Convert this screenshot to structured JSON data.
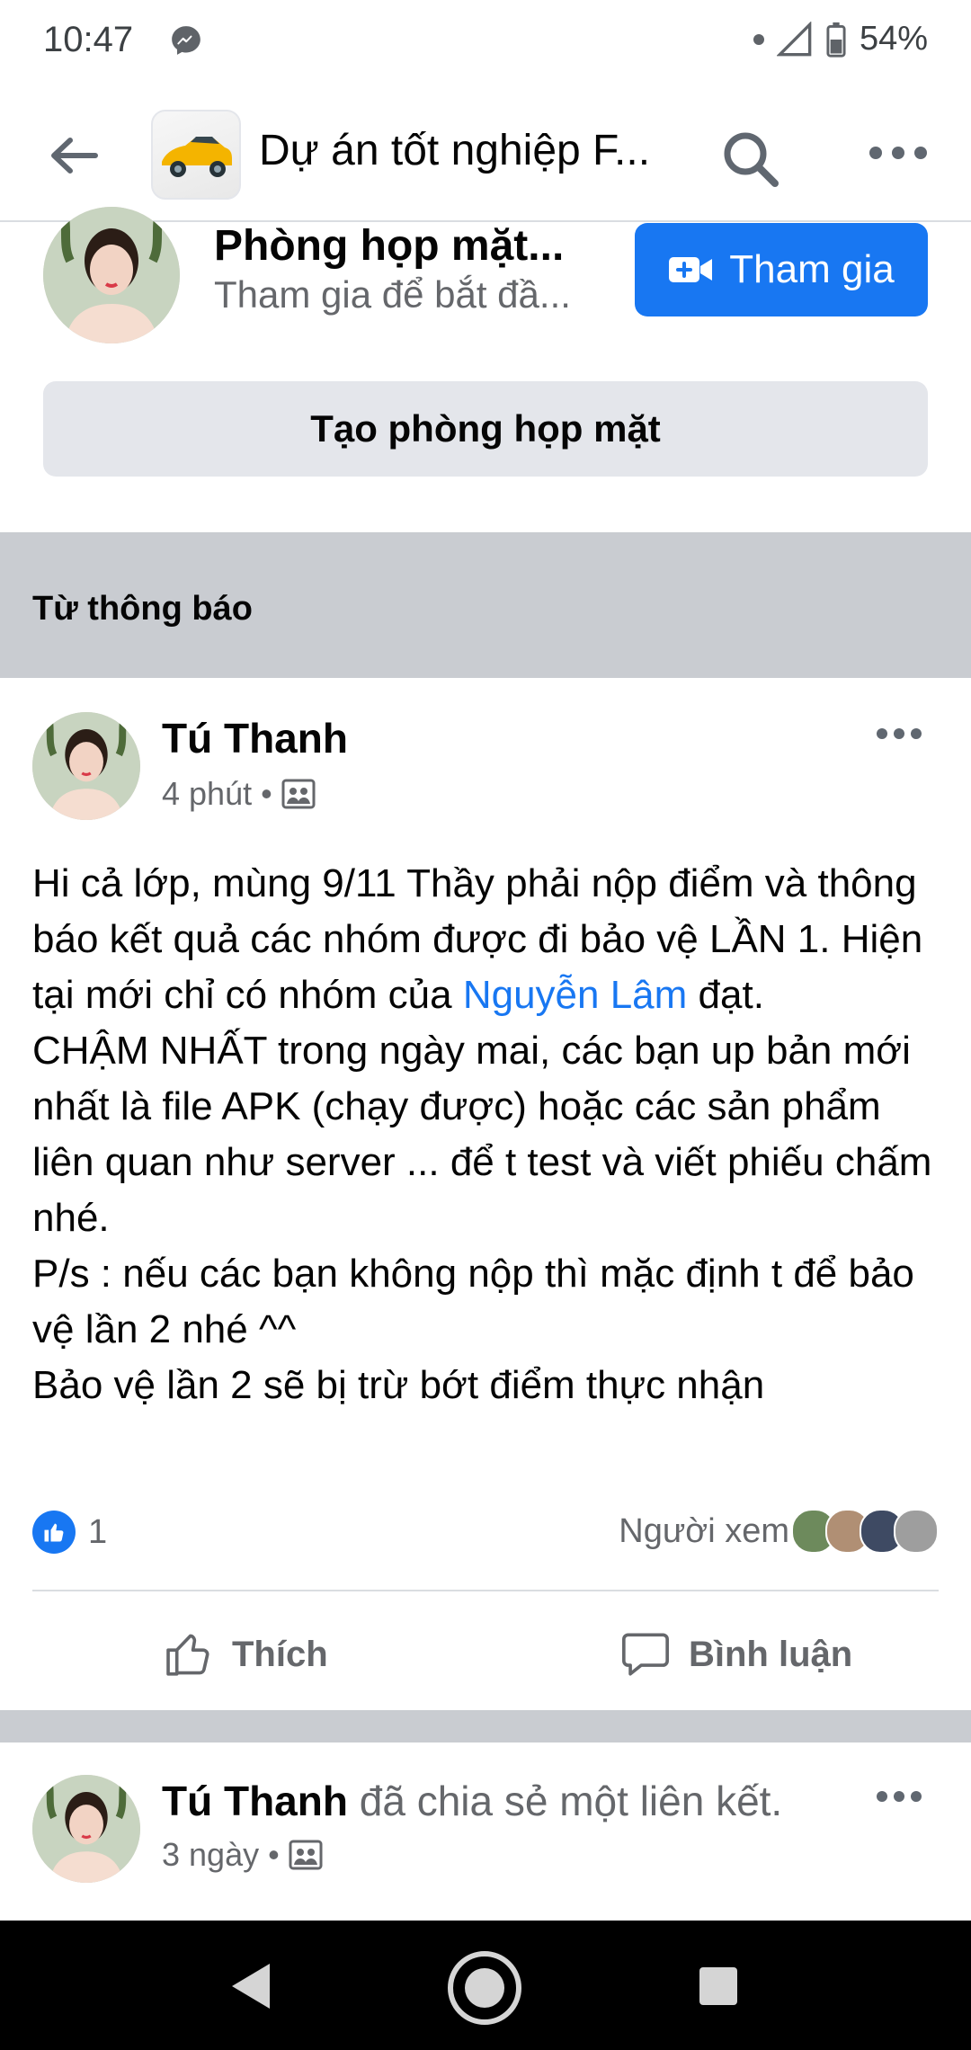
{
  "status_bar": {
    "time": "10:47",
    "notification_icon": "messenger-icon",
    "battery": "54%"
  },
  "app_bar": {
    "back_icon": "back-arrow-icon",
    "group_title": "Dự án tốt nghiệp F...",
    "search_icon": "search-icon",
    "more_icon": "more-horizontal-icon"
  },
  "room": {
    "title": "Phòng họp mặt...",
    "subtitle": "Tham gia để bắt đầ...",
    "join_label": "Tham gia",
    "create_label": "Tạo phòng họp mặt"
  },
  "section": {
    "label": "Từ thông báo"
  },
  "post": {
    "author": "Tú Thanh",
    "time": "4 phút",
    "body": {
      "p1_a": "Hi cả lớp, mùng 9/11 Thầy phải nộp điểm và thông báo kết quả các nhóm được đi bảo vệ LẦN 1. Hiện tại mới chỉ có nhóm của ",
      "p1_mention": "Nguyễn Lâm",
      "p1_b": " đạt.",
      "p2": "CHẬM NHẤT trong ngày mai, các bạn up bản mới nhất là file APK (chạy được) hoặc các sản phẩm liên quan như server ... để t test và viết phiếu chấm nhé.",
      "p3": "P/s : nếu các bạn không nộp thì mặc định t để bảo vệ lần 2 nhé ^^",
      "p4": "Bảo vệ lần 2 sẽ bị trừ bớt điểm thực nhận"
    },
    "like_count": "1",
    "viewers_label": "Người xem",
    "like_label": "Thích",
    "comment_label": "Bình luận"
  },
  "post2": {
    "author": "Tú Thanh",
    "action_text": "đã chia sẻ một liên kết.",
    "time": "3 ngày"
  },
  "colors": {
    "accent": "#1877f2",
    "secondary_text": "#65676b",
    "section_bg": "#c9ccd1"
  }
}
